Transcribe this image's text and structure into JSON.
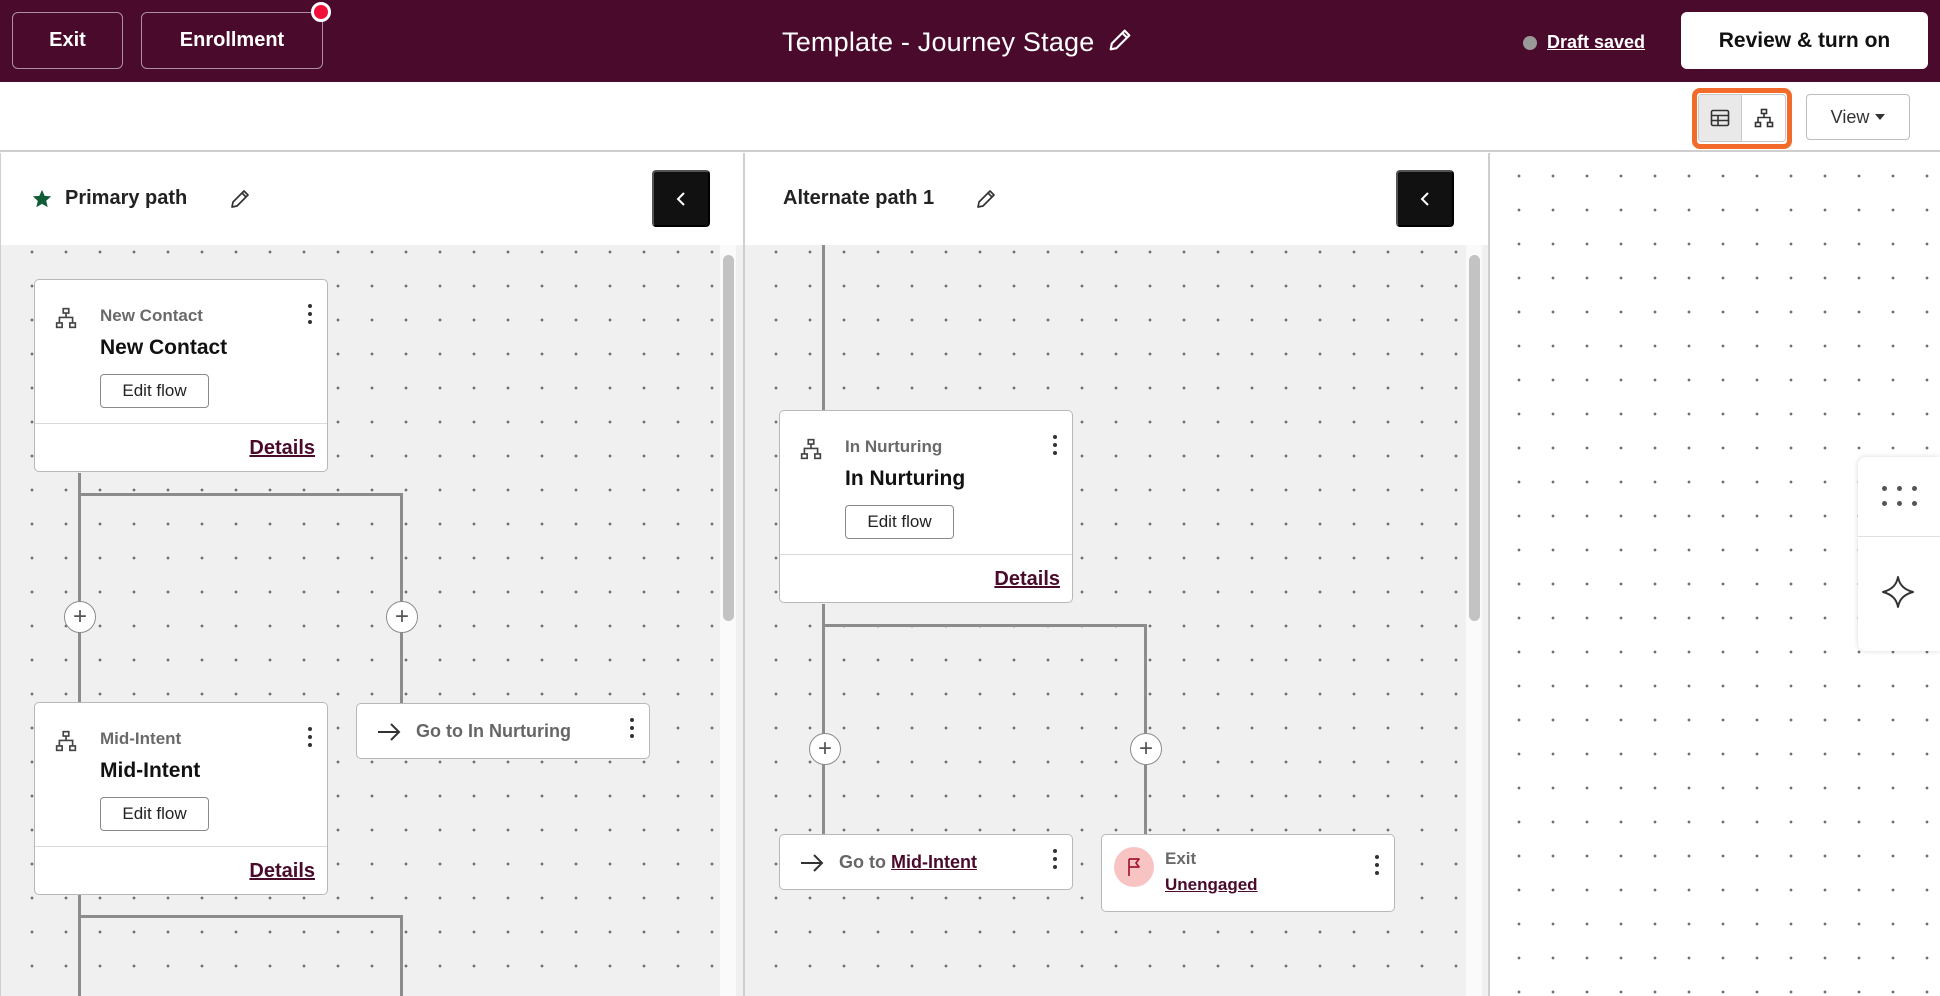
{
  "header": {
    "exit_label": "Exit",
    "enrollment_label": "Enrollment",
    "title": "Template - Journey Stage",
    "draft_status": "Draft saved",
    "review_label": "Review & turn on"
  },
  "toolbar": {
    "view_label": "View",
    "toggle_options": [
      "table-view-icon",
      "tree-view-icon"
    ],
    "highlight_color": "#f26b2a"
  },
  "panels": {
    "primary": {
      "title": "Primary path",
      "nodes": [
        {
          "type_label": "New Contact",
          "name": "New Contact",
          "edit_label": "Edit flow",
          "details_label": "Details"
        },
        {
          "type_label": "Mid-Intent",
          "name": "Mid-Intent",
          "edit_label": "Edit flow",
          "details_label": "Details"
        }
      ],
      "goto": {
        "prefix": "Go to In Nurturing"
      }
    },
    "alternate": {
      "title": "Alternate path 1",
      "nodes": [
        {
          "type_label": "In Nurturing",
          "name": "In Nurturing",
          "edit_label": "Edit flow",
          "details_label": "Details"
        }
      ],
      "goto": {
        "prefix": "Go to",
        "link": "Mid-Intent"
      },
      "exit": {
        "label": "Exit",
        "link": "Unengaged"
      }
    }
  },
  "colors": {
    "brand": "#4a0a2b",
    "notification": "#f0103a",
    "exit_badge": "#f8c3c3"
  }
}
